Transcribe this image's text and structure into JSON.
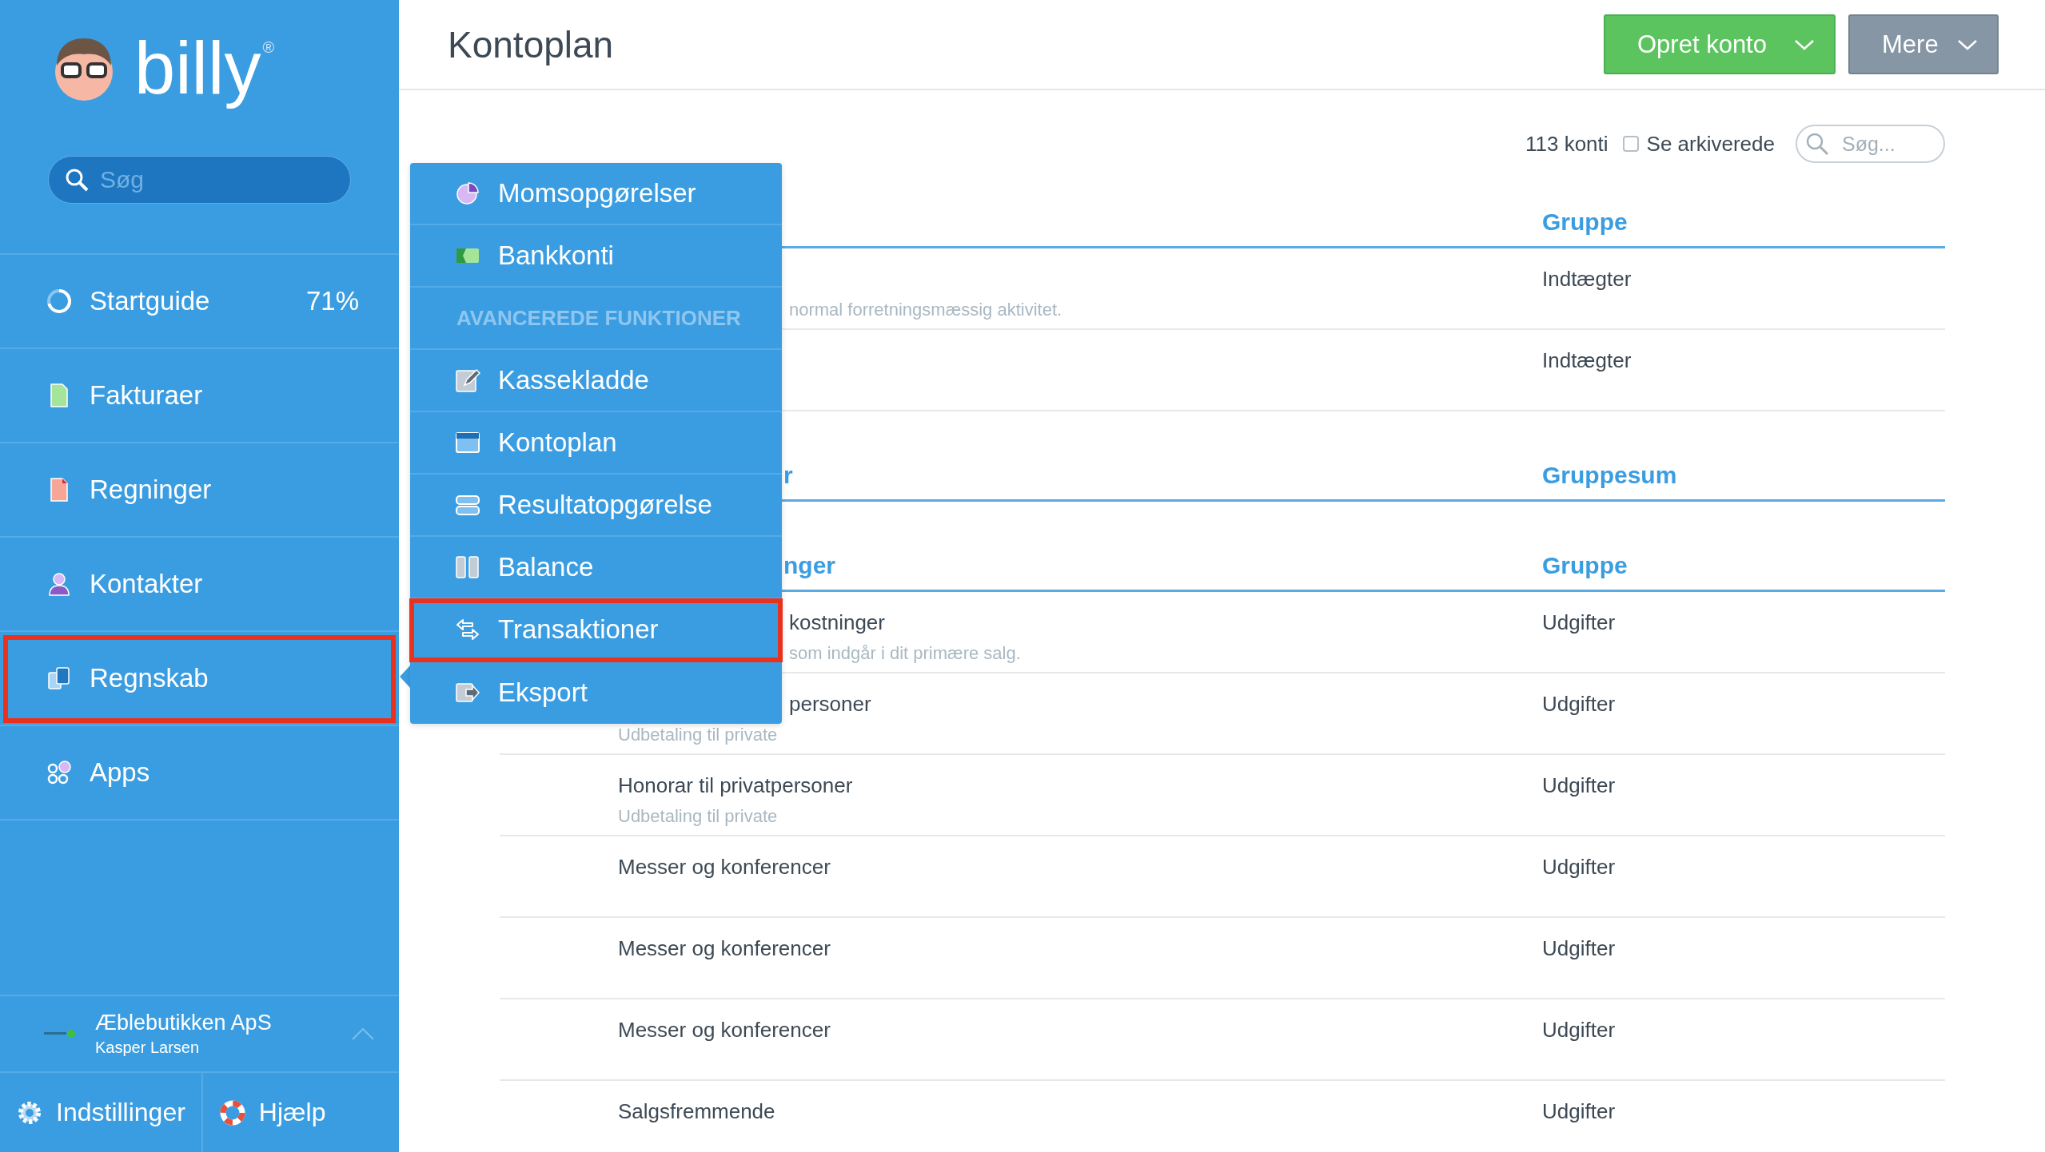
{
  "sidebar": {
    "logo": {
      "text": "billy",
      "mark": "®"
    },
    "search": {
      "placeholder": "Søg"
    },
    "nav": [
      {
        "label": "Startguide",
        "badge": "71%",
        "level": 0.71,
        "highlighted": false
      },
      {
        "label": "Fakturaer",
        "highlighted": false
      },
      {
        "label": "Regninger",
        "highlighted": false
      },
      {
        "label": "Kontakter",
        "highlighted": false
      },
      {
        "label": "Regnskab",
        "highlighted": true
      },
      {
        "label": "Apps",
        "highlighted": false
      }
    ],
    "organization": {
      "name": "Æblebutikken ApS",
      "user": "Kasper Larsen"
    },
    "footer": [
      {
        "label": "Indstillinger"
      },
      {
        "label": "Hjælp"
      }
    ]
  },
  "header": {
    "title": "Kontoplan",
    "buttons": [
      {
        "label": "Opret konto",
        "kind": "primary"
      },
      {
        "label": "Mere",
        "kind": "secondary"
      }
    ]
  },
  "toolbar": {
    "count": "113 konti",
    "show_archived": {
      "label": "Se arkiverede",
      "checked": false
    },
    "search": {
      "placeholder": "Søg..."
    }
  },
  "sections": [
    {
      "group_header": "Gruppe",
      "rows": [
        {
          "kind": "cut",
          "description": "normal forretningsmæssig aktivitet.",
          "group": "Indtægter"
        },
        {
          "kind": "full",
          "group": "Indtægter"
        }
      ]
    },
    {
      "header": "r",
      "group_header": "Gruppesum"
    },
    {
      "header": "nger",
      "group_header": "Gruppe",
      "rows": [
        {
          "kind": "cut",
          "name": "kostninger",
          "description": "som indgår i dit primære salg.",
          "group": "Udgifter"
        },
        {
          "kind": "name-cut",
          "name": "personer",
          "description": "Udbetaling til private",
          "group": "Udgifter"
        },
        {
          "kind": "full",
          "name": "Honorar til privatpersoner",
          "description": "Udbetaling til private",
          "group": "Udgifter"
        },
        {
          "kind": "full",
          "name": "Messer og konferencer",
          "group": "Udgifter"
        },
        {
          "kind": "full",
          "name": "Messer og konferencer",
          "group": "Udgifter"
        },
        {
          "kind": "full",
          "name": "Messer og konferencer",
          "group": "Udgifter"
        },
        {
          "kind": "full",
          "name": "Salgsfremmende",
          "group": "Udgifter"
        }
      ]
    }
  ],
  "flyout_menu": {
    "items": [
      {
        "kind": "item",
        "label": "Momsopgørelser",
        "highlighted": false
      },
      {
        "kind": "item",
        "label": "Bankkonti",
        "highlighted": false
      },
      {
        "kind": "heading",
        "label": "AVANCEREDE FUNKTIONER"
      },
      {
        "kind": "item",
        "label": "Kassekladde",
        "highlighted": false
      },
      {
        "kind": "item",
        "label": "Kontoplan",
        "highlighted": false
      },
      {
        "kind": "item",
        "label": "Resultatopgørelse",
        "highlighted": false
      },
      {
        "kind": "item",
        "label": "Balance",
        "highlighted": false
      },
      {
        "kind": "item",
        "label": "Transaktioner",
        "highlighted": true
      },
      {
        "kind": "item",
        "label": "Eksport",
        "highlighted": false
      }
    ]
  }
}
